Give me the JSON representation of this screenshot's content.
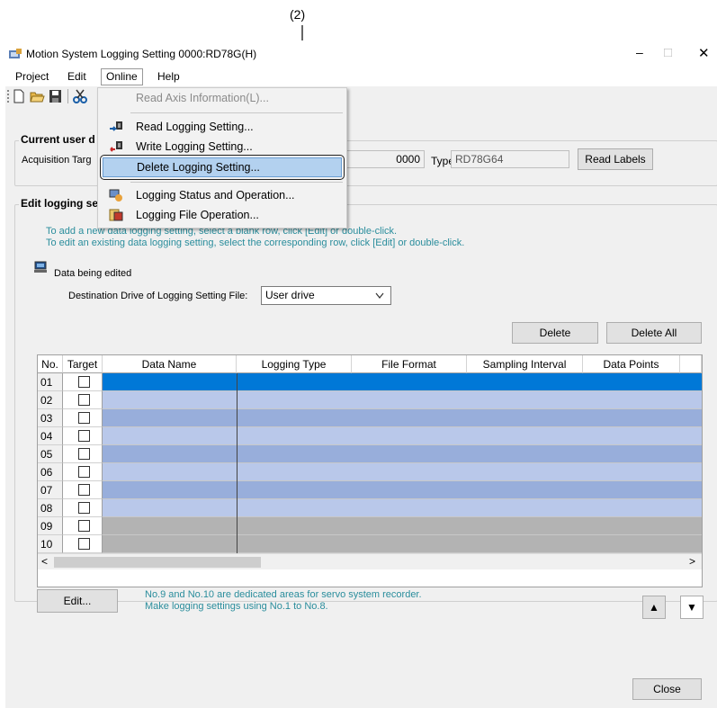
{
  "callout": {
    "label": "(2)"
  },
  "window": {
    "title": "Motion System Logging Setting 0000:RD78G(H)",
    "controls": {
      "minimize": "–",
      "maximize": "□",
      "close": "✕"
    }
  },
  "menubar": {
    "items": [
      "Project",
      "Edit",
      "Online",
      "Help"
    ]
  },
  "online_menu": {
    "items": [
      {
        "label": "Read Axis Information(L)...",
        "icon": "",
        "disabled": true
      },
      {
        "label": "Read Logging Setting...",
        "icon": "read-icon",
        "disabled": false
      },
      {
        "label": "Write Logging Setting...",
        "icon": "write-icon",
        "disabled": false
      },
      {
        "label": "Delete Logging Setting...",
        "icon": "",
        "disabled": false,
        "highlighted": true
      },
      {
        "label": "Logging Status and Operation...",
        "icon": "status-icon",
        "disabled": false
      },
      {
        "label": "Logging File Operation...",
        "icon": "file-icon",
        "disabled": false
      }
    ]
  },
  "current_user": {
    "title": "Current user d",
    "acquisition_label": "Acquisition Targ",
    "address_value": "0000",
    "type_label": "Type:",
    "type_value": "RD78G64",
    "read_labels_button": "Read Labels"
  },
  "edit_logging": {
    "title": "Edit logging se",
    "info_line1": "To add a new data logging setting, select a blank row, click [Edit] or double-click.",
    "info_line2": "To edit an existing data logging setting, select the corresponding row, click [Edit] or double-click.",
    "data_being_edited": "Data being edited",
    "destination_label": "Destination Drive of Logging Setting File:",
    "destination_value": "User drive",
    "delete_button": "Delete",
    "delete_all_button": "Delete All",
    "columns": [
      "No.",
      "Target",
      "Data Name",
      "Logging Type",
      "File Format",
      "Sampling Interval",
      "Data Points"
    ],
    "rows": [
      "01",
      "02",
      "03",
      "04",
      "05",
      "06",
      "07",
      "08",
      "09",
      "10"
    ],
    "edit_button": "Edit...",
    "note_line1": "No.9 and No.10 are dedicated areas for servo system recorder.",
    "note_line2": "Make logging settings using No.1 to No.8.",
    "up_icon": "▲",
    "down_icon": "▼",
    "scroll_left": "<",
    "scroll_right": ">"
  },
  "close_button": "Close"
}
